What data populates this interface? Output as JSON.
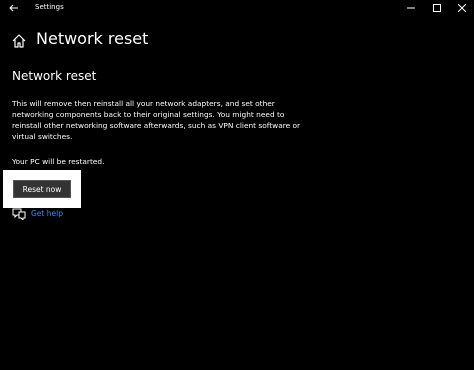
{
  "window": {
    "title": "Settings",
    "minimize_icon": "minimize-icon",
    "maximize_icon": "maximize-icon",
    "close_icon": "close-icon"
  },
  "header": {
    "title": "Network reset",
    "home_icon": "home-icon",
    "back_icon": "back-arrow-icon"
  },
  "content": {
    "section_title": "Network reset",
    "description": "This will remove then reinstall all your network adapters, and set other networking components back to their original settings. You might need to reinstall other networking software afterwards, such as VPN client software or virtual switches.",
    "restart_note": "Your PC will be restarted.",
    "reset_button": "Reset now",
    "help_link": "Get help",
    "help_icon": "help-chat-icon"
  },
  "colors": {
    "background": "#000000",
    "text": "#ffffff",
    "link": "#2d8cff",
    "button_bg": "#333333",
    "highlight": "#ffffff"
  }
}
